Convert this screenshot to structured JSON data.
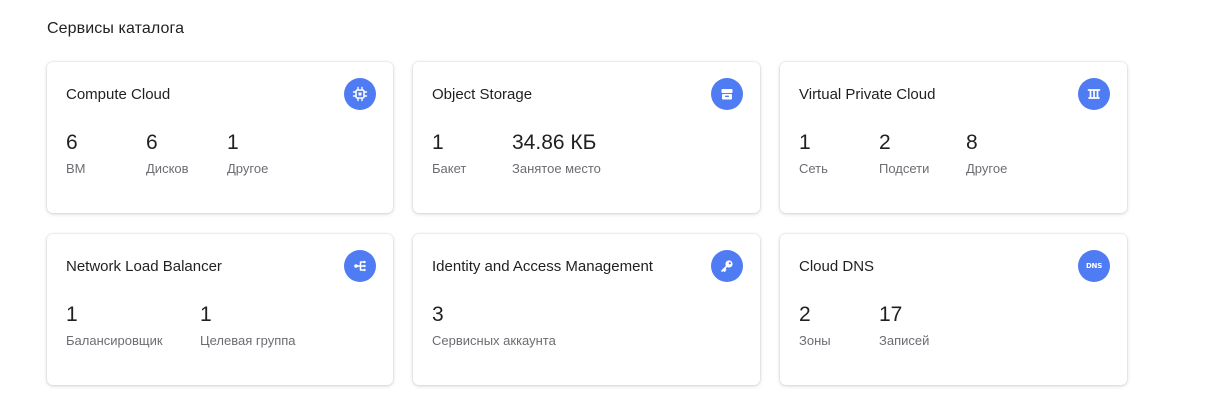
{
  "section": {
    "title": "Сервисы каталога"
  },
  "accent_color": "#4f7cf2",
  "cards": [
    {
      "title": "Compute Cloud",
      "icon": "chip-icon",
      "stats": [
        {
          "value": "6",
          "label": "ВМ"
        },
        {
          "value": "6",
          "label": "Дисков"
        },
        {
          "value": "1",
          "label": "Другое"
        }
      ]
    },
    {
      "title": "Object Storage",
      "icon": "storage-bucket-icon",
      "stats": [
        {
          "value": "1",
          "label": "Бакет"
        },
        {
          "value": "34.86 КБ",
          "label": "Занятое место"
        }
      ]
    },
    {
      "title": "Virtual Private Cloud",
      "icon": "network-icon",
      "stats": [
        {
          "value": "1",
          "label": "Сеть"
        },
        {
          "value": "2",
          "label": "Подсети"
        },
        {
          "value": "8",
          "label": "Другое"
        }
      ]
    },
    {
      "title": "Network Load Balancer",
      "icon": "load-balancer-icon",
      "stats": [
        {
          "value": "1",
          "label": "Балансировщик"
        },
        {
          "value": "1",
          "label": "Целевая группа"
        }
      ]
    },
    {
      "title": "Identity and Access Management",
      "icon": "key-icon",
      "stats": [
        {
          "value": "3",
          "label": "Сервисных аккаунта"
        }
      ]
    },
    {
      "title": "Cloud DNS",
      "icon": "dns-icon",
      "icon_text": "DNS",
      "stats": [
        {
          "value": "2",
          "label": "Зоны"
        },
        {
          "value": "17",
          "label": "Записей"
        }
      ]
    }
  ]
}
